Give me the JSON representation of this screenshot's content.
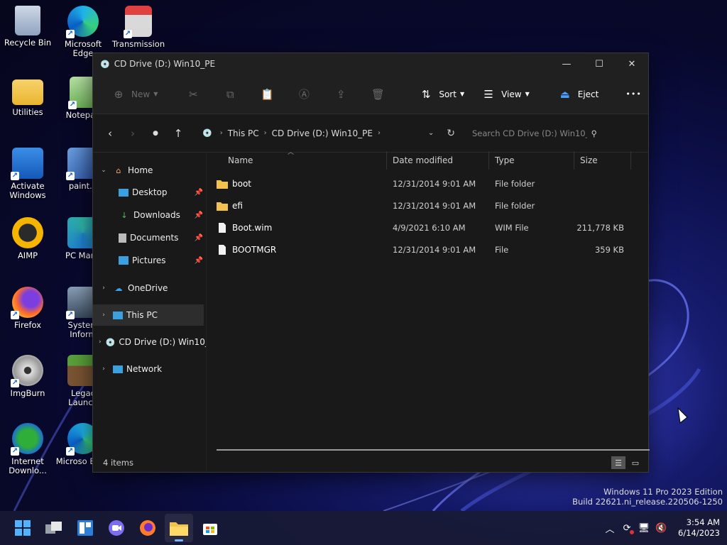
{
  "desktop": {
    "icons": [
      {
        "label": "Recycle Bin",
        "name": "recycle-bin-icon"
      },
      {
        "label": "Microsoft Edge",
        "name": "edge-icon"
      },
      {
        "label": "Transmission",
        "name": "transmission-icon"
      },
      {
        "label": "Utilities",
        "name": "folder-icon"
      },
      {
        "label": "Notepad",
        "name": "notepad-icon"
      },
      {
        "label": "Activate Windows",
        "name": "activate-windows-icon"
      },
      {
        "label": "paint.n",
        "name": "paint-icon"
      },
      {
        "label": "AIMP",
        "name": "aimp-icon"
      },
      {
        "label": "PC Mana",
        "name": "pc-manager-icon"
      },
      {
        "label": "Firefox",
        "name": "firefox-icon"
      },
      {
        "label": "System Inform",
        "name": "system-info-icon"
      },
      {
        "label": "ImgBurn",
        "name": "imgburn-icon"
      },
      {
        "label": "Legac Launch",
        "name": "legacy-launcher-icon"
      },
      {
        "label": "Internet Downlo...",
        "name": "idm-icon"
      },
      {
        "label": "Microso Edge",
        "name": "edge-icon"
      }
    ]
  },
  "window": {
    "title": "CD Drive (D:) Win10_PE",
    "controls": {
      "minimize": "—",
      "maximize": "☐",
      "close": "✕"
    }
  },
  "toolbar": {
    "new_label": "New",
    "sort_label": "Sort",
    "view_label": "View",
    "eject_label": "Eject",
    "more_label": "•••"
  },
  "address": {
    "segments": [
      "This PC",
      "CD Drive (D:) Win10_PE"
    ],
    "search_placeholder": "Search CD Drive (D:) Win10_..."
  },
  "nav": {
    "home": "Home",
    "quick_access": [
      "Desktop",
      "Downloads",
      "Documents",
      "Pictures"
    ],
    "onedrive": "OneDrive",
    "this_pc": "This PC",
    "cd_drive": "CD Drive (D:) Win10_",
    "network": "Network"
  },
  "columns": {
    "name": "Name",
    "date": "Date modified",
    "type": "Type",
    "size": "Size"
  },
  "files": [
    {
      "name": "boot",
      "date": "12/31/2014 9:01 AM",
      "type": "File folder",
      "size": "",
      "kind": "folder"
    },
    {
      "name": "efi",
      "date": "12/31/2014 9:01 AM",
      "type": "File folder",
      "size": "",
      "kind": "folder"
    },
    {
      "name": "Boot.wim",
      "date": "4/9/2021 6:10 AM",
      "type": "WIM File",
      "size": "211,778 KB",
      "kind": "file"
    },
    {
      "name": "BOOTMGR",
      "date": "12/31/2014 9:01 AM",
      "type": "File",
      "size": "359 KB",
      "kind": "file"
    }
  ],
  "status": {
    "item_count": "4 items"
  },
  "watermark": {
    "line1": "Windows 11 Pro 2023 Edition",
    "line2": "Build 22621.ni_release.220506-1250"
  },
  "clock": {
    "time": "3:54 AM",
    "date": "6/14/2023"
  },
  "colors": {
    "accent": "#4a9eff",
    "folder": "#f2c14e",
    "window_bg": "#191919"
  }
}
